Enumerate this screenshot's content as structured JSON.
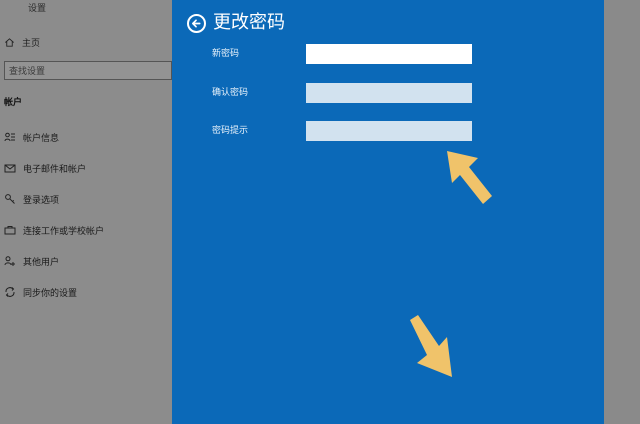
{
  "window": {
    "title": "设置"
  },
  "settings": {
    "home_label": "主页",
    "search_placeholder": "查找设置",
    "section_label": "帐户",
    "nav_items": [
      {
        "label": "帐户信息",
        "icon": "person-card-icon"
      },
      {
        "label": "电子邮件和帐户",
        "icon": "mail-icon"
      },
      {
        "label": "登录选项",
        "icon": "key-icon"
      },
      {
        "label": "连接工作或学校帐户",
        "icon": "briefcase-icon"
      },
      {
        "label": "其他用户",
        "icon": "add-person-icon"
      },
      {
        "label": "同步你的设置",
        "icon": "sync-icon"
      }
    ]
  },
  "dialog": {
    "title": "更改密码",
    "back_icon": "back-arrow-icon",
    "fields": [
      {
        "label": "新密码",
        "value": ""
      },
      {
        "label": "确认密码",
        "value": ""
      },
      {
        "label": "密码提示",
        "value": ""
      }
    ]
  },
  "colors": {
    "dialog_blue": "#0b69b8",
    "dimmed_background": "#8c8c8c",
    "annotation_arrow": "#f0c36a"
  }
}
